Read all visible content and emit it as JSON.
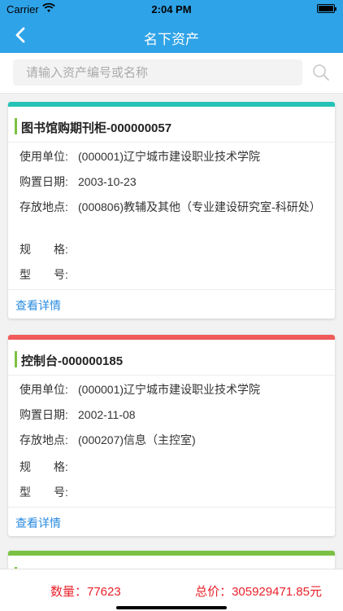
{
  "status": {
    "carrier": "Carrier",
    "time": "2:04 PM"
  },
  "nav": {
    "title": "名下资产",
    "back_icon": "chevron-left-icon"
  },
  "search": {
    "placeholder": "请输入资产编号或名称",
    "value": "",
    "icon": "search-icon"
  },
  "labels": {
    "unit": "使用单位:",
    "date": "购置日期:",
    "location": "存放地点:",
    "spec": "规　　格:",
    "model": "型　　号:",
    "details": "查看详情"
  },
  "assets": [
    {
      "name": "图书馆购期刊柜-000000057",
      "unit": "(000001)辽宁城市建设职业技术学院",
      "date": "2003-10-23",
      "location": "(000806)教辅及其他（专业建设研究室-科研处）",
      "spec": "",
      "model": "",
      "color": "#25c2b7"
    },
    {
      "name": "控制台-000000185",
      "unit": "(000001)辽宁城市建设职业技术学院",
      "date": "2002-11-08",
      "location": "(000207)信息（主控室)",
      "spec": "",
      "model": "",
      "color": "#f05a5a"
    },
    {
      "name": "",
      "color": "#7cc143"
    }
  ],
  "summary": {
    "qty": "数量：77623",
    "price": "总价：305929471.85元"
  }
}
